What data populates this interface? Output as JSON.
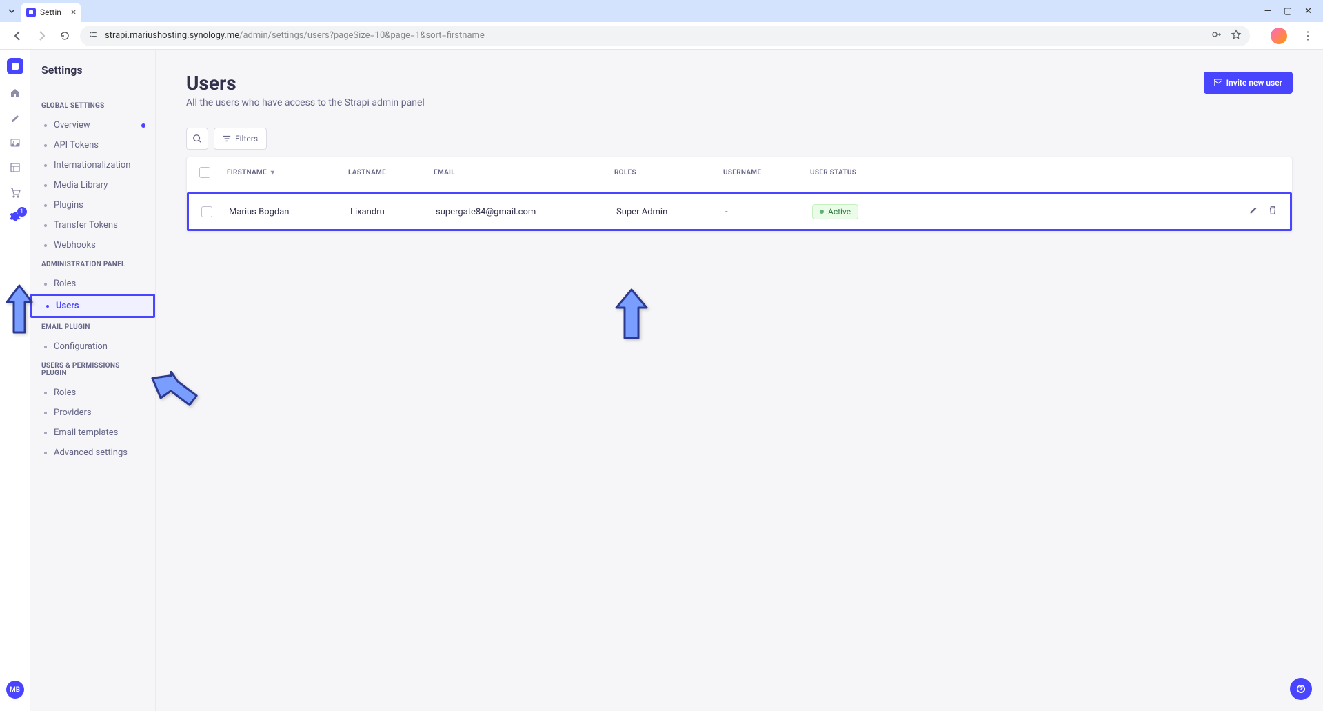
{
  "browser": {
    "tab_title": "Settin",
    "url_host": "strapi.mariushosting.synology.me",
    "url_path": "/admin/settings/users?pageSize=10&page=1&sort=firstname"
  },
  "iconbar": {
    "settings_badge": "1",
    "avatar_initials": "MB"
  },
  "sidebar": {
    "title": "Settings",
    "sections": [
      {
        "label": "GLOBAL SETTINGS",
        "items": [
          {
            "label": "Overview",
            "has_dot": true
          },
          {
            "label": "API Tokens"
          },
          {
            "label": "Internationalization"
          },
          {
            "label": "Media Library"
          },
          {
            "label": "Plugins"
          },
          {
            "label": "Transfer Tokens"
          },
          {
            "label": "Webhooks"
          }
        ]
      },
      {
        "label": "ADMINISTRATION PANEL",
        "items": [
          {
            "label": "Roles"
          },
          {
            "label": "Users",
            "selected": true
          }
        ]
      },
      {
        "label": "EMAIL PLUGIN",
        "items": [
          {
            "label": "Configuration"
          }
        ]
      },
      {
        "label": "USERS & PERMISSIONS PLUGIN",
        "items": [
          {
            "label": "Roles"
          },
          {
            "label": "Providers"
          },
          {
            "label": "Email templates"
          },
          {
            "label": "Advanced settings"
          }
        ]
      }
    ]
  },
  "main": {
    "title": "Users",
    "subtitle": "All the users who have access to the Strapi admin panel",
    "invite_label": "Invite new user",
    "filters_label": "Filters",
    "columns": {
      "firstname": "FIRSTNAME",
      "lastname": "LASTNAME",
      "email": "EMAIL",
      "roles": "ROLES",
      "username": "USERNAME",
      "status": "USER STATUS"
    },
    "rows": [
      {
        "firstname": "Marius Bogdan",
        "lastname": "Lixandru",
        "email": "supergate84@gmail.com",
        "roles": "Super Admin",
        "username": "-",
        "status": "Active"
      }
    ]
  }
}
